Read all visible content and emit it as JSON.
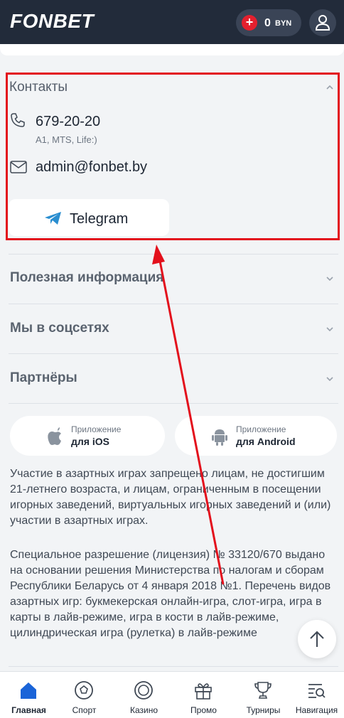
{
  "header": {
    "logo": "FONBET",
    "plus": "+",
    "balance_amount": "0",
    "balance_currency": "BYN"
  },
  "contacts": {
    "title": "Контакты",
    "phone": "679-20-20",
    "phone_operators": "A1, MTS, Life:)",
    "email": "admin@fonbet.by",
    "telegram_label": "Telegram"
  },
  "sections": [
    {
      "title": "Полезная информация"
    },
    {
      "title": "Мы в соцсетях"
    },
    {
      "title": "Партнёры"
    }
  ],
  "apps": {
    "ios": {
      "small": "Приложение",
      "big": "для iOS"
    },
    "android": {
      "small": "Приложение",
      "big": "для Android"
    }
  },
  "legal": {
    "para1": "Участие в азартных играх запрещено лицам, не достигшим 21-летнего возраста, и лицам, ограниченным в посещении игорных заведений, виртуальных игорных заведений и (или) участии в азартных играх.",
    "para2": "Специальное разрешение (лицензия) № 33120/670 выдано на основании решения Министерства по налогам и сборам Республики Беларусь от 4 января 2018 №1. Перечень видов азартных игр: букмекерская онлайн-игра, слот-игра, игра в карты в лайв-режиме, игра в кости в лайв-режиме, цилиндрическая игра (рулетка) в лайв-режиме"
  },
  "nav": [
    {
      "label": "Главная",
      "icon": "home-icon",
      "active": true
    },
    {
      "label": "Спорт",
      "icon": "soccer-ball-icon"
    },
    {
      "label": "Казино",
      "icon": "casino-chip-icon"
    },
    {
      "label": "Промо",
      "icon": "gift-icon"
    },
    {
      "label": "Турниры",
      "icon": "trophy-icon"
    },
    {
      "label": "Навигация",
      "icon": "navigation-search-icon"
    }
  ],
  "colors": {
    "header_bg": "#222b3a",
    "accent_red": "#e4202e",
    "annotation_red": "#e3101c",
    "telegram_blue": "#2a8ed0"
  }
}
